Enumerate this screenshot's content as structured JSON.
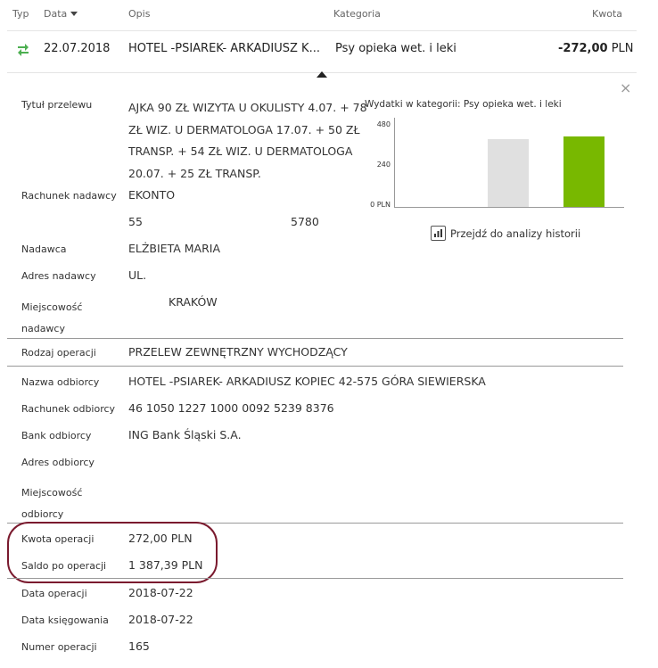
{
  "header": {
    "col_type": "Typ",
    "col_date": "Data",
    "col_desc": "Opis",
    "col_category": "Kategoria",
    "col_amount": "Kwota"
  },
  "transaction": {
    "icon": "transfer-arrows-icon",
    "date": "22.07.2018",
    "desc": "HOTEL -PSIAREK- ARKADIUSZ K...",
    "category": "Psy opieka wet. i leki",
    "amount": "-272,00",
    "currency": "PLN"
  },
  "details": {
    "title_label": "Tytuł przelewu",
    "title_lines": [
      "AJKA 90 ZŁ WIZYTA U OKULISTY 4.07. + 78",
      "ZŁ WIZ. U DERMATOLOGA 17.07. + 50 ZŁ",
      "TRANSP. + 54 ZŁ WIZ. U DERMATOLOGA",
      "20.07. + 25 ZŁ TRANSP."
    ],
    "sender_account_label": "Rachunek nadawcy",
    "sender_account_name": "EKONTO",
    "sender_account_no_start": "55",
    "sender_account_no_end": "5780",
    "sender_label": "Nadawca",
    "sender_value": "ELŻBIETA MARIA",
    "sender_address_label": "Adres nadawcy",
    "sender_address_value": "UL.",
    "sender_city_label_1": "Miejscowość",
    "sender_city_label_2": "nadawcy",
    "sender_city_value": "KRAKÓW",
    "op_type_label": "Rodzaj operacji",
    "op_type_value": "PRZELEW ZEWNĘTRZNY WYCHODZĄCY",
    "recipient_label": "Nazwa odbiorcy",
    "recipient_value": "HOTEL -PSIAREK- ARKADIUSZ KOPIEC 42-575 GÓRA SIEWIERSKA",
    "recipient_account_label": "Rachunek odbiorcy",
    "recipient_account_value": "46 1050 1227 1000 0092 5239 8376",
    "recipient_bank_label": "Bank odbiorcy",
    "recipient_bank_value": "ING Bank Śląski S.A.",
    "recipient_address_label": "Adres odbiorcy",
    "recipient_city_label_1": "Miejscowość",
    "recipient_city_label_2": "odbiorcy",
    "op_amount_label": "Kwota operacji",
    "op_amount_value": "272,00 PLN",
    "balance_label": "Saldo po operacji",
    "balance_value": "1 387,39 PLN",
    "op_date_label": "Data operacji",
    "op_date_value": "2018-07-22",
    "booking_date_label": "Data księgowania",
    "booking_date_value": "2018-07-22",
    "op_number_label": "Numer operacji",
    "op_number_value": "165"
  },
  "chart_link": "Przejdź do analizy historii",
  "close_symbol": "×",
  "colors": {
    "bar_prev": "#e0e0e0",
    "bar_current": "#78b800",
    "icon_green": "#4caf50",
    "highlight": "#7a1a2e"
  },
  "chart_data": {
    "type": "bar",
    "title": "Wydatki w kategorii:  Psy opieka wet. i leki",
    "yticks": [
      "480",
      "240",
      "0 PLN"
    ],
    "ylim": [
      0,
      480
    ],
    "values": [
      395,
      410
    ],
    "grid": false,
    "legend": "none"
  }
}
